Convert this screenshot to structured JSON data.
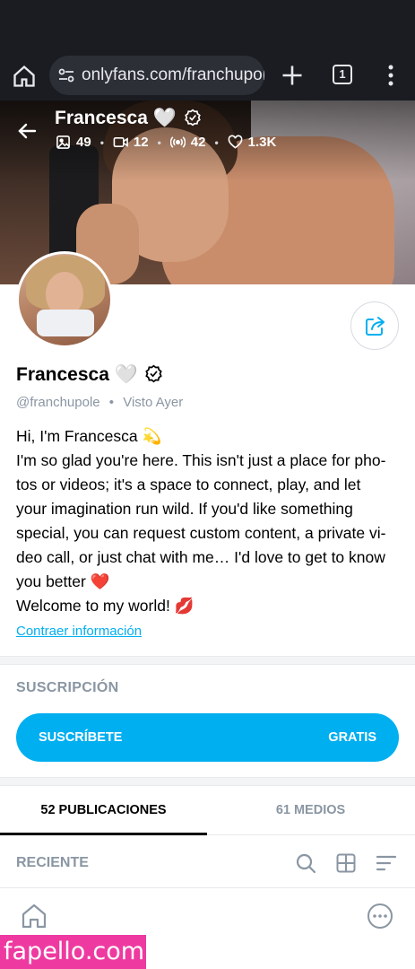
{
  "browser": {
    "url": "onlyfans.com/franchupol",
    "tab_count": "1"
  },
  "header": {
    "name": "Francesca",
    "heart_emoji": "🤍",
    "stats": {
      "photos": "49",
      "videos": "12",
      "streams": "42",
      "likes": "1.3K"
    }
  },
  "profile": {
    "name": "Francesca",
    "heart_emoji": "🤍",
    "handle": "@franchupole",
    "separator": "•",
    "seen_label": "Visto",
    "seen_value": "Ayer",
    "bio_lines": [
      "Hi, I'm Francesca 💫",
      "I'm so glad you're here. This isn't just a place for pho-",
      "tos or videos; it's a space to connect, play, and let",
      "your imagination run wild. If you'd like something",
      "special, you can request custom content, a private vi-",
      "deo call, or just chat with me… I'd love to get to know",
      "you better ❤️",
      "Welcome to my world! 💋"
    ],
    "collapse_link": "Contraer información"
  },
  "subscription": {
    "title": "SUSCRIPCIÓN",
    "button_label": "SUSCRÍBETE",
    "button_price": "GRATIS"
  },
  "tabs": [
    {
      "label": "52 PUBLICACIONES",
      "active": true
    },
    {
      "label": "61 MEDIOS",
      "active": false
    }
  ],
  "filter": {
    "label": "RECIENTE"
  },
  "watermark": "fapello.com",
  "colors": {
    "accent": "#00aff0",
    "muted": "#8a96a3",
    "chrome_bg": "#1a1c22",
    "watermark_bg": "#ee3aa0"
  }
}
